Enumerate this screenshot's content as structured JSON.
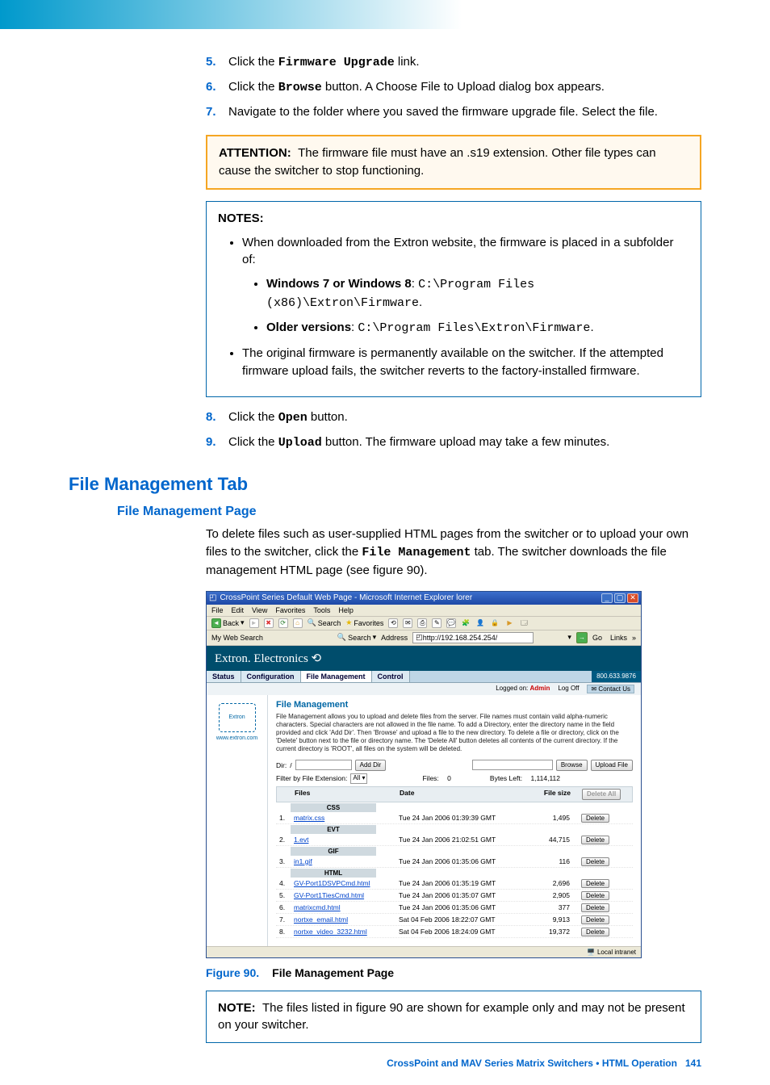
{
  "steps1": [
    {
      "n": "5.",
      "pre": "Click the ",
      "bold": "Firmware Upgrade",
      "post": " link."
    },
    {
      "n": "6.",
      "pre": "Click the ",
      "bold": "Browse",
      "post": " button. A Choose File to Upload dialog box appears."
    },
    {
      "n": "7.",
      "pre": "Navigate to the folder where you saved the firmware upgrade file. Select the file.",
      "bold": "",
      "post": ""
    }
  ],
  "attention": {
    "head": "ATTENTION:",
    "text": "The firmware file must have an .s19 extension. Other file types can cause the switcher to stop functioning."
  },
  "notes": {
    "head": "NOTES:",
    "b1": "When downloaded from the Extron website, the firmware is placed in a subfolder of:",
    "sub1_label": "Windows 7 or Windows 8",
    "sub1_path": "C:\\Program Files (x86)\\Extron\\Firmware",
    "sub2_label": "Older versions",
    "sub2_path": "C:\\Program Files\\Extron\\Firmware",
    "b2": "The original firmware is permanently available on the switcher. If the attempted firmware upload fails, the switcher reverts to the factory-installed firmware."
  },
  "steps2": [
    {
      "n": "8.",
      "pre": "Click the ",
      "bold": "Open",
      "post": " button."
    },
    {
      "n": "9.",
      "pre": "Click the ",
      "bold": "Upload",
      "post": " button. The firmware upload may take a few minutes."
    }
  ],
  "h2": "File Management Tab",
  "h3": "File Management Page",
  "para_pre": "To delete files such as user-supplied HTML pages from the switcher or to upload your own files to the switcher, click the ",
  "para_bold": "File Management",
  "para_post": " tab. The switcher downloads the file management HTML page (see figure 90).",
  "fig": {
    "lbl": "Figure 90.",
    "ttl": "File Management Page"
  },
  "note2": {
    "head": "NOTE:",
    "text": "The files listed in figure 90 are shown for example only and may not be present on your switcher."
  },
  "footer": {
    "text": "CrossPoint and MAV Series Matrix Switchers • HTML Operation",
    "page": "141"
  },
  "ie": {
    "title": "CrossPoint Series Default Web Page - Microsoft Internet Explorer  lorer",
    "menu": [
      "File",
      "Edit",
      "View",
      "Favorites",
      "Tools",
      "Help"
    ],
    "back": "Back",
    "search": "Search",
    "fav": "Favorites",
    "mywebsearch": "My Web Search",
    "searchbtn": "Search",
    "addrlbl": "Address",
    "url": "http://192.168.254.254/",
    "go": "Go",
    "links": "Links"
  },
  "ext": {
    "brand": "Extron. Electronics ⟲",
    "tabs": [
      "Status",
      "Configuration",
      "File Management",
      "Control"
    ],
    "phone": "800.633.9876",
    "logged": "Logged on:",
    "role": "Admin",
    "logoff": "Log Off",
    "contact": "Contact Us",
    "sidelink": "www.extron.com",
    "fmTitle": "File Management",
    "fmDesc": "File Management allows you to upload and delete files from the server. File names must contain valid alpha-numeric characters. Special characters are not allowed in the file name. To add a Directory, enter the directory name in the field provided and click 'Add Dir'. Then 'Browse' and upload a file to the new directory. To delete a file or directory, click on the 'Delete' button next to the file or directory name. The 'Delete All' button deletes all contents of the current directory. If the current directory is 'ROOT', all files on the system will be deleted.",
    "dirLbl": "Dir:",
    "dirVal": "/",
    "addDir": "Add Dir",
    "browse": "Browse",
    "uploadFile": "Upload File",
    "filterLbl": "Filter by File Extension:",
    "filterVal": "All",
    "filesLbl": "Files:",
    "filesVal": "0",
    "bytesLbl": "Bytes Left:",
    "bytesVal": "1,114,112",
    "cols": {
      "files": "Files",
      "date": "Date",
      "size": "File size"
    },
    "deleteAll": "Delete All",
    "delete": "Delete",
    "groups": [
      {
        "name": "CSS",
        "rows": [
          {
            "i": "1.",
            "f": "matrix.css",
            "d": "Tue 24 Jan 2006 01:39:39 GMT",
            "s": "1,495"
          }
        ]
      },
      {
        "name": "EVT",
        "rows": [
          {
            "i": "2.",
            "f": "1.evt",
            "d": "Tue 24 Jan 2006 21:02:51 GMT",
            "s": "44,715"
          }
        ]
      },
      {
        "name": "GIF",
        "rows": [
          {
            "i": "3.",
            "f": "in1.gif",
            "d": "Tue 24 Jan 2006 01:35:06 GMT",
            "s": "116"
          }
        ]
      },
      {
        "name": "HTML",
        "rows": [
          {
            "i": "4.",
            "f": "GV-Port1DSVPCmd.html",
            "d": "Tue 24 Jan 2006 01:35:19 GMT",
            "s": "2,696"
          },
          {
            "i": "5.",
            "f": "GV-Port1TiesCmd.html",
            "d": "Tue 24 Jan 2006 01:35:07 GMT",
            "s": "2,905"
          },
          {
            "i": "6.",
            "f": "matrixcmd.html",
            "d": "Tue 24 Jan 2006 01:35:06 GMT",
            "s": "377"
          },
          {
            "i": "7.",
            "f": "nortxe_email.html",
            "d": "Sat 04 Feb 2006 18:22:07 GMT",
            "s": "9,913"
          },
          {
            "i": "8.",
            "f": "nortxe_video_3232.html",
            "d": "Sat 04 Feb 2006 18:24:09 GMT",
            "s": "19,372"
          }
        ]
      }
    ],
    "status": "Local intranet"
  }
}
